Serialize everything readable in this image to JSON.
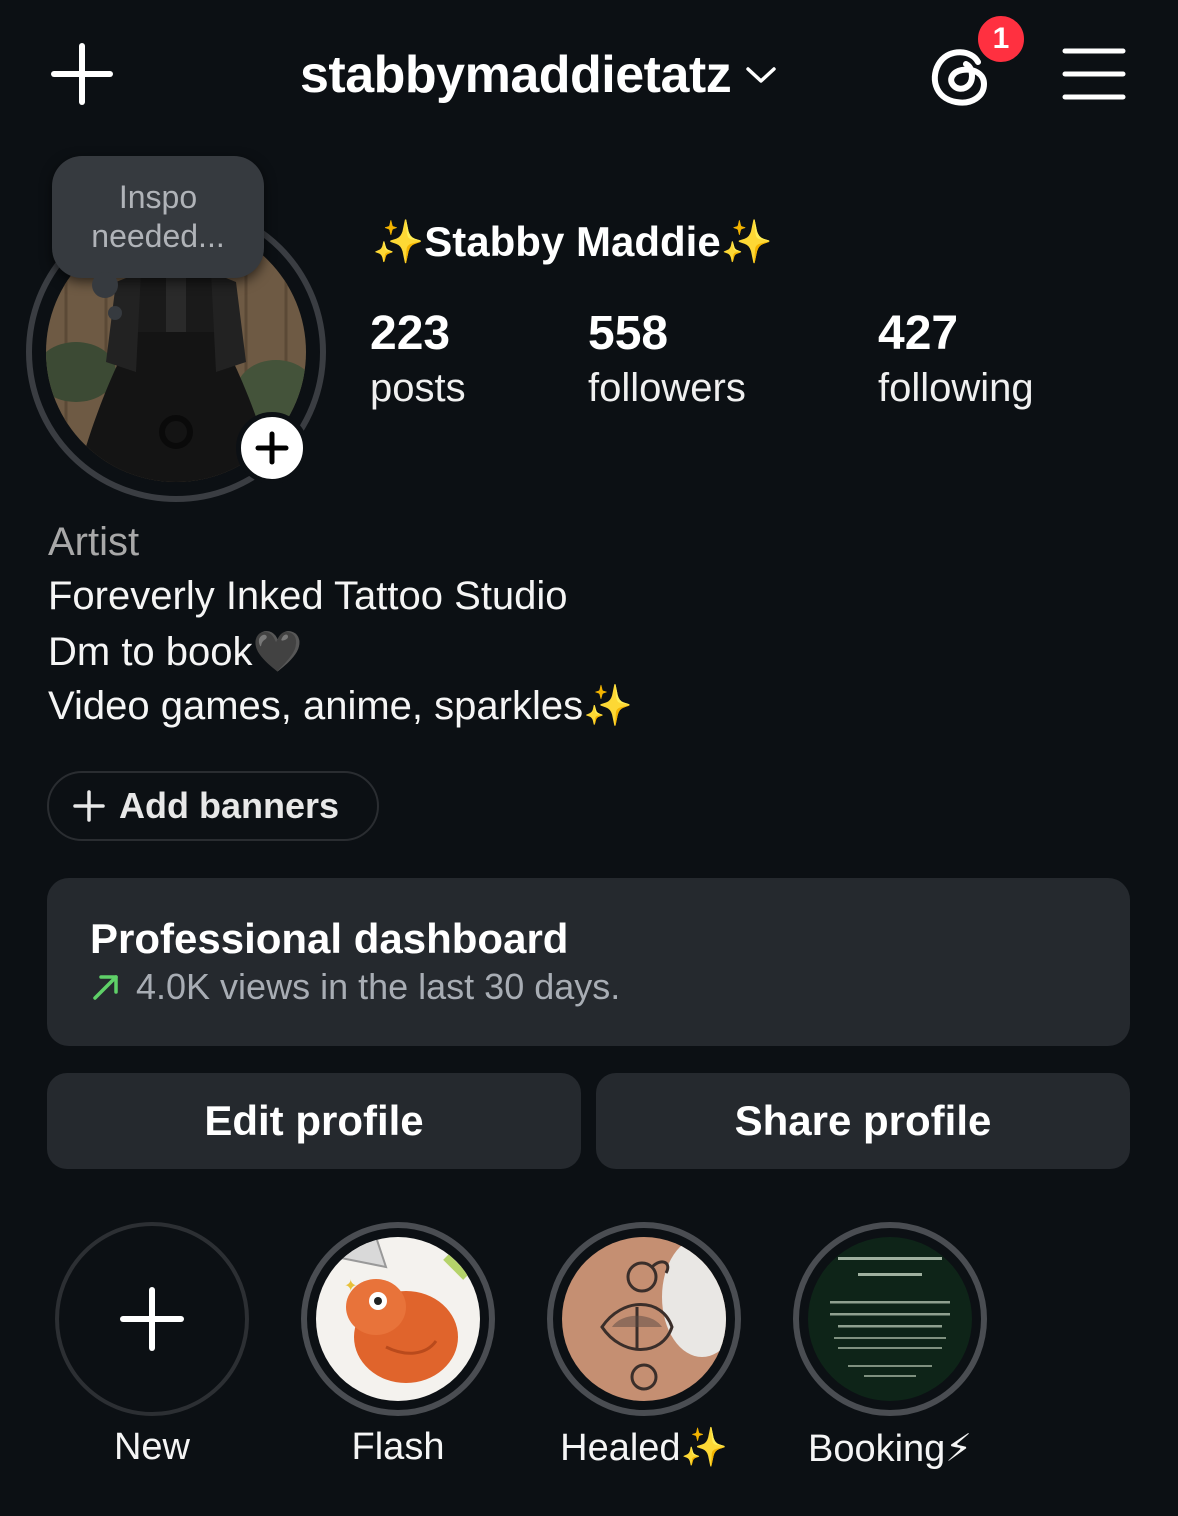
{
  "header": {
    "username": "stabbymaddietatz",
    "notification_count": "1",
    "icons": [
      "plus-icon",
      "chevron-down-icon",
      "threads-icon",
      "hamburger-menu-icon"
    ]
  },
  "profile": {
    "note": "Inspo needed...",
    "display_name": "✨Stabby Maddie✨",
    "stats": {
      "posts_count": "223",
      "posts_label": "posts",
      "followers_count": "558",
      "followers_label": "followers",
      "following_count": "427",
      "following_label": "following"
    },
    "bio": {
      "category": "Artist",
      "line1": "Foreverly Inked Tattoo Studio",
      "line2": "Dm to book🖤",
      "line3": "Video games, anime, sparkles✨"
    }
  },
  "banners": {
    "add_label": "Add banners"
  },
  "dashboard": {
    "title": "Professional dashboard",
    "subtitle": "4.0K views in the last 30 days."
  },
  "actions": {
    "edit_label": "Edit profile",
    "share_label": "Share profile"
  },
  "highlights": [
    {
      "label": "New"
    },
    {
      "label": "Flash"
    },
    {
      "label": "Healed✨"
    },
    {
      "label": "Booking⚡"
    }
  ],
  "colors": {
    "background": "#0c1014",
    "card": "#25292e",
    "badge": "#ff3040",
    "trend_arrow": "#5fd068",
    "muted_text": "#a8a8a8"
  }
}
